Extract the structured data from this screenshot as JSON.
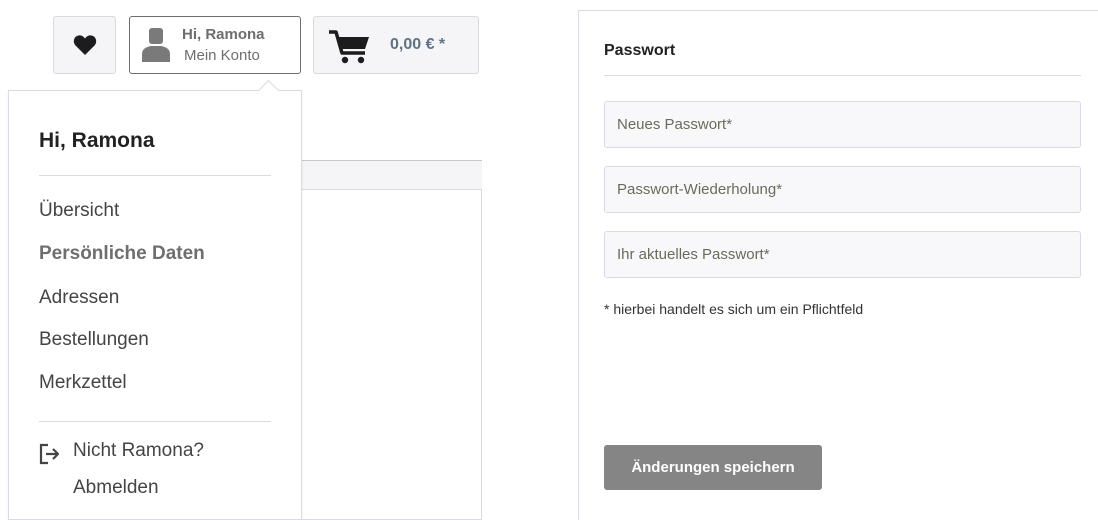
{
  "header": {
    "wishlist_icon": "heart-icon",
    "account": {
      "greeting": "Hi, Ramona",
      "subtitle": "Mein Konto",
      "icon": "user-icon"
    },
    "cart": {
      "amount": "0,00 € *",
      "icon": "cart-icon"
    }
  },
  "account_menu": {
    "title": "Hi, Ramona",
    "items": [
      {
        "label": "Übersicht",
        "active": false
      },
      {
        "label": "Persönliche Daten",
        "active": true
      },
      {
        "label": "Adressen",
        "active": false
      },
      {
        "label": "Bestellungen",
        "active": false
      },
      {
        "label": "Merkzettel",
        "active": false
      }
    ],
    "logout": {
      "line1": "Nicht Ramona?",
      "line2": "Abmelden",
      "icon": "logout-icon"
    }
  },
  "password_form": {
    "title": "Passwort",
    "fields": [
      {
        "placeholder": "Neues Passwort*",
        "value": ""
      },
      {
        "placeholder": "Passwort-Wiederholung*",
        "value": ""
      },
      {
        "placeholder": "Ihr aktuelles Passwort*",
        "value": ""
      }
    ],
    "required_note": "* hierbei handelt es sich um ein Pflichtfeld",
    "save_label": "Änderungen speichern"
  },
  "colors": {
    "accent_grey": "#6e6e6e",
    "cart_blue": "#5f7285",
    "button_grey": "#858585",
    "border": "#dadae5"
  }
}
